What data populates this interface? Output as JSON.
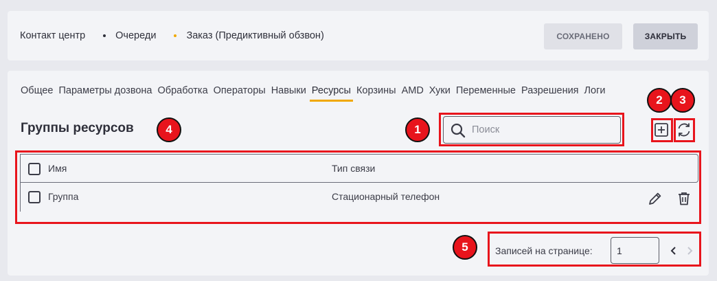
{
  "breadcrumb": {
    "items": [
      {
        "label": "Контакт центр"
      },
      {
        "label": "Очереди",
        "dot_color": "#2e2f3a"
      },
      {
        "label": "Заказ (Предиктивный обзвон)",
        "dot_color": "#f0a800"
      }
    ]
  },
  "header_buttons": {
    "saved": "СОХРАНЕНО",
    "close": "ЗАКРЫТЬ"
  },
  "tabs": [
    {
      "label": "Общее"
    },
    {
      "label": "Параметры дозвона"
    },
    {
      "label": "Обработка"
    },
    {
      "label": "Операторы"
    },
    {
      "label": "Навыки"
    },
    {
      "label": "Ресурсы",
      "active": true
    },
    {
      "label": "Корзины"
    },
    {
      "label": "AMD"
    },
    {
      "label": "Хуки"
    },
    {
      "label": "Переменные"
    },
    {
      "label": "Разрешения"
    },
    {
      "label": "Логи"
    }
  ],
  "section": {
    "title": "Группы ресурсов"
  },
  "search": {
    "placeholder": "Поиск",
    "value": ""
  },
  "toolbar": {
    "add_icon": "plus-square-icon",
    "refresh_icon": "refresh-icon"
  },
  "table": {
    "columns": [
      "Имя",
      "Тип связи"
    ],
    "rows": [
      {
        "name": "Группа",
        "type": "Стационарный телефон",
        "actions": [
          "pencil-icon",
          "trash-icon"
        ]
      }
    ]
  },
  "pagination": {
    "label": "Записей на странице:",
    "page_size": "1"
  },
  "annotations": {
    "badges": [
      "1",
      "2",
      "3",
      "4",
      "5"
    ],
    "highlight_color": "#e8141c",
    "accent_color": "#f0a800"
  }
}
